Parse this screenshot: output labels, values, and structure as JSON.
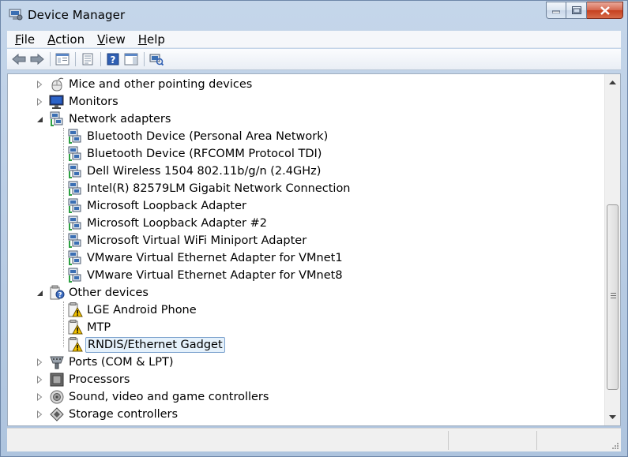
{
  "window": {
    "title": "Device Manager"
  },
  "menu": [
    {
      "label": "File",
      "key": "F",
      "rest": "ile"
    },
    {
      "label": "Action",
      "key": "A",
      "rest": "ction"
    },
    {
      "label": "View",
      "key": "V",
      "rest": "iew"
    },
    {
      "label": "Help",
      "key": "H",
      "rest": "elp"
    }
  ],
  "toolbar": [
    "back-icon",
    "forward-icon",
    "show-hide-console-tree-icon",
    "properties-icon",
    "help-icon",
    "action-pane-icon",
    "scan-hardware-icon"
  ],
  "tree": {
    "categories": [
      {
        "label": "Mice and other pointing devices",
        "icon": "mouse-icon",
        "expanded": false
      },
      {
        "label": "Monitors",
        "icon": "monitor-icon",
        "expanded": false
      },
      {
        "label": "Network adapters",
        "icon": "network-adapter-icon",
        "expanded": true,
        "children": [
          "Bluetooth Device (Personal Area Network)",
          "Bluetooth Device (RFCOMM Protocol TDI)",
          "Dell Wireless 1504 802.11b/g/n (2.4GHz)",
          "Intel(R) 82579LM Gigabit Network Connection",
          "Microsoft Loopback Adapter",
          "Microsoft Loopback Adapter #2",
          "Microsoft Virtual WiFi Miniport Adapter",
          "VMware Virtual Ethernet Adapter for VMnet1",
          "VMware Virtual Ethernet Adapter for VMnet8"
        ]
      },
      {
        "label": "Other devices",
        "icon": "unknown-device-icon",
        "expanded": true,
        "children": [
          "LGE Android Phone",
          "MTP",
          "RNDIS/Ethernet Gadget"
        ],
        "selected": "RNDIS/Ethernet Gadget"
      },
      {
        "label": "Ports (COM & LPT)",
        "icon": "port-icon",
        "expanded": false
      },
      {
        "label": "Processors",
        "icon": "processor-icon",
        "expanded": false
      },
      {
        "label": "Sound, video and game controllers",
        "icon": "speaker-icon",
        "expanded": false
      },
      {
        "label": "Storage controllers",
        "icon": "storage-controller-icon",
        "expanded": false
      }
    ]
  },
  "colors": {
    "selection_bg": "#e5f1fb",
    "selection_border": "#7da2ce",
    "warning": "#f2c200"
  }
}
